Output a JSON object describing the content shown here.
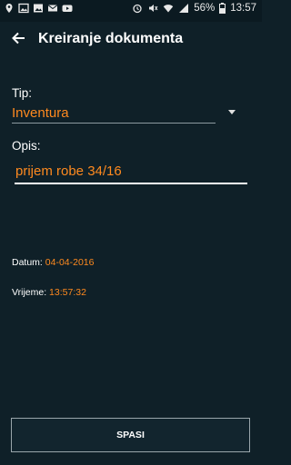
{
  "status_bar": {
    "time": "13:57",
    "battery_percent": "56%",
    "left_icons": [
      "location-icon",
      "photo-icon",
      "gallery-icon",
      "mail-icon",
      "youtube-icon"
    ],
    "right_icons": [
      "alarm-icon",
      "mute-icon",
      "wifi-icon",
      "signal-icon",
      "battery-icon"
    ]
  },
  "app_bar": {
    "title": "Kreiranje dokumenta",
    "back_icon": "arrow-left-icon"
  },
  "form": {
    "tip_label": "Tip:",
    "tip_value": "Inventura",
    "opis_label": "Opis:",
    "opis_value": "prijem robe 34/16"
  },
  "info": {
    "datum_label": "Datum:",
    "datum_value": "04-04-2016",
    "vrijeme_label": "Vrijeme:",
    "vrijeme_value": "13:57:32"
  },
  "actions": {
    "save_label": "SPASI"
  },
  "colors": {
    "background": "#0f2028",
    "accent": "#ff8a1f",
    "text": "#ffffff"
  }
}
